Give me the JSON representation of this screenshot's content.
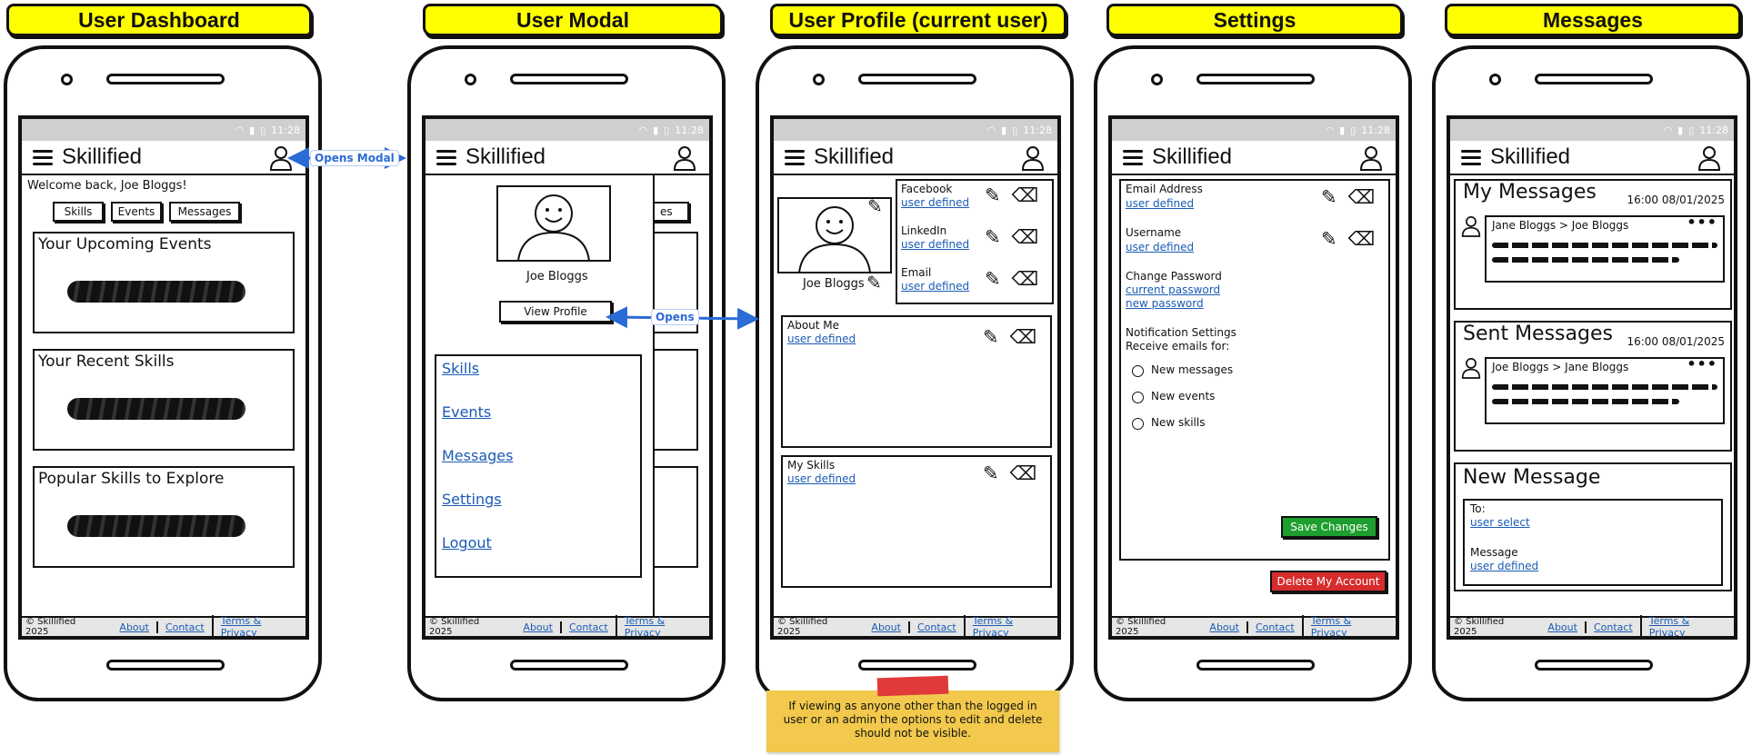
{
  "titles": [
    "User Dashboard",
    "User Modal",
    "User Profile (current user)",
    "Settings",
    "Messages"
  ],
  "app": {
    "brand": "Skillified",
    "time": "11:28"
  },
  "footer": {
    "copyright": "© Skillified 2025",
    "about": "About",
    "contact": "Contact",
    "terms": "Terms & Privacy"
  },
  "dashboard": {
    "welcome": "Welcome back, Joe Bloggs!",
    "buttons": [
      "Skills",
      "Events",
      "Messages"
    ],
    "sections": [
      "Your Upcoming Events",
      "Your Recent Skills",
      "Popular Skills to Explore"
    ]
  },
  "modal": {
    "name": "Joe Bloggs",
    "view_profile": "View Profile",
    "links": [
      "Skills",
      "Events",
      "Messages",
      "Settings",
      "Logout"
    ],
    "behind_fragment": "es"
  },
  "profile": {
    "name": "Joe Bloggs",
    "socials": [
      {
        "label": "Facebook",
        "value": "user defined"
      },
      {
        "label": "LinkedIn",
        "value": "user defined"
      },
      {
        "label": "Email",
        "value": "user defined"
      }
    ],
    "about_label": "About Me",
    "about_value": "user defined",
    "skills_label": "My Skills",
    "skills_value": "user defined"
  },
  "settings": {
    "email_label": "Email Address",
    "email_value": "user defined",
    "username_label": "Username",
    "username_value": "user defined",
    "password_label": "Change Password",
    "current_password": "current password",
    "new_password": "new password",
    "notif_label": "Notification Settings",
    "receive_label": "Receive emails for:",
    "options": [
      "New messages",
      "New events",
      "New skills"
    ],
    "save": "Save Changes",
    "delete": "Delete My Account",
    "colors": {
      "save": "#1e9e2e",
      "delete": "#d62c2c"
    }
  },
  "messages": {
    "my_title": "My Messages",
    "my_time": "16:00 08/01/2025",
    "my_header": "Jane Bloggs > Joe Bloggs",
    "sent_title": "Sent Messages",
    "sent_time": "16:00 08/01/2025",
    "sent_header": "Joe Bloggs > Jane Bloggs",
    "new_title": "New Message",
    "to_label": "To:",
    "to_value": "user select",
    "msg_label": "Message",
    "msg_value": "user defined"
  },
  "connectors": {
    "opens_modal": "Opens Modal",
    "opens": "Opens"
  },
  "note": "If viewing as anyone other than the logged in user or an admin the options to edit and delete should not be visible.",
  "icons": [
    "hamburger-icon",
    "user-icon",
    "pencil-icon",
    "eraser-icon",
    "wifi-icon",
    "signal-icon",
    "battery-icon",
    "more-icon"
  ]
}
